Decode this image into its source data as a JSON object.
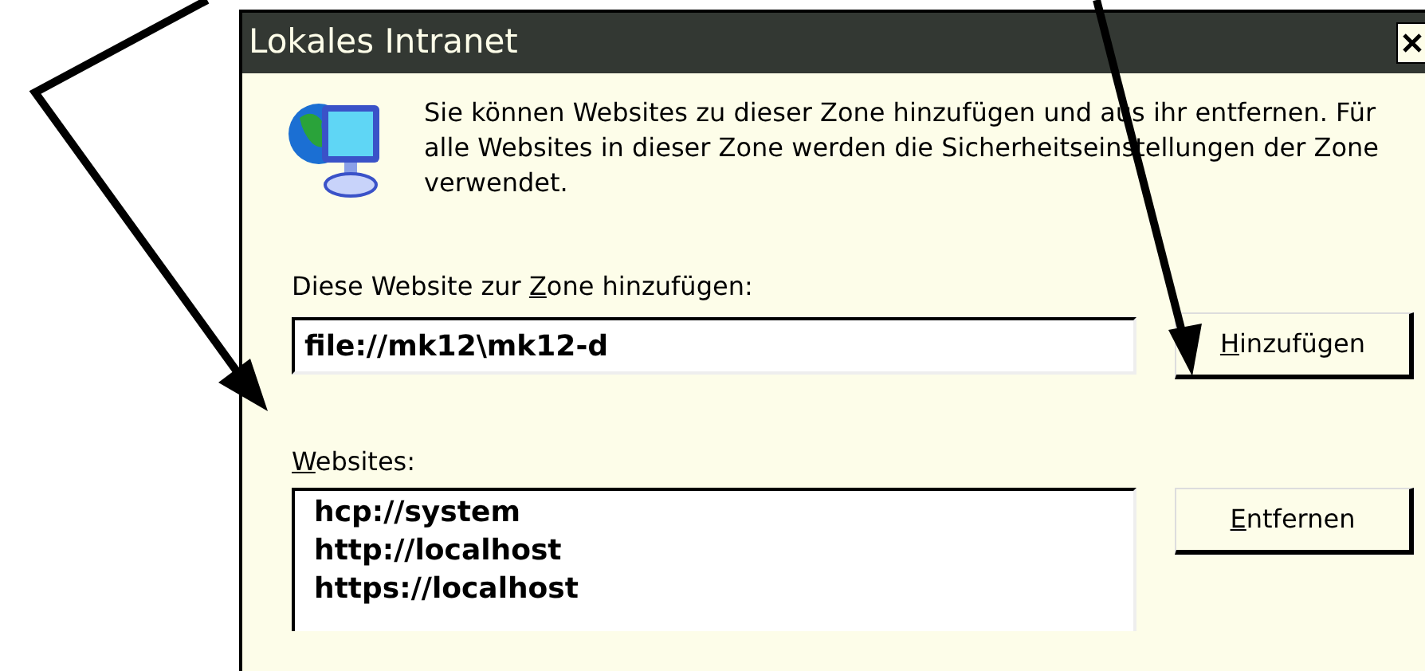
{
  "window": {
    "title": "Lokales Intranet"
  },
  "description": "Sie können Websites zu dieser Zone hinzufügen und aus ihr entfernen. Für alle Websites in dieser Zone werden die Sicherheitseinstellungen der Zone verwendet.",
  "add_site": {
    "label": {
      "before": "Diese Website zur ",
      "key": "Z",
      "after": "one hinzufügen:"
    },
    "value": "file://mk12\\mk12-d",
    "button": {
      "key": "H",
      "after": "inzufügen"
    }
  },
  "websites": {
    "label": {
      "key": "W",
      "after": "ebsites:"
    },
    "items": [
      "hcp://system",
      "http://localhost",
      "https://localhost"
    ],
    "button": {
      "key": "E",
      "after": "ntfernen"
    }
  }
}
